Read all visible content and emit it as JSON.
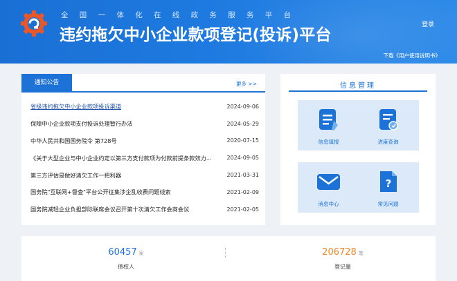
{
  "header": {
    "subtitle": "全国一体化在线政务服务平台",
    "title": "违约拖欠中小企业款项登记(投诉)平台",
    "login_label": "登录",
    "download_label": "下载《用户使用说明书》"
  },
  "notice": {
    "tab_label": "通知公告",
    "more_label": "更多 >>",
    "items": [
      {
        "title": "省级违约拖欠中小企业款项投诉渠道",
        "date": "2024-09-06"
      },
      {
        "title": "保障中小企业款项支付投诉处理暂行办法",
        "date": "2024-05-29"
      },
      {
        "title": "中华人民共和国国务院令 第728号",
        "date": "2020-07-15"
      },
      {
        "title": "《关于大型企业与中小企业约定以第三方支付款项为付款前提条款效力...",
        "date": "2024-09-05"
      },
      {
        "title": "第三方评估是做好清欠工作一把利器",
        "date": "2021-03-31"
      },
      {
        "title": "国务院\"互联网+督查\"平台公开征集涉企乱收费问题线索",
        "date": "2021-02-09"
      },
      {
        "title": "国务院减轻企业负担部际联席会议召开第十次清欠工作会商会议",
        "date": "2021-02-05"
      }
    ]
  },
  "info": {
    "title": "信息管理",
    "tiles": [
      {
        "label": "信息填报",
        "icon": "document-edit-icon"
      },
      {
        "label": "进度查询",
        "icon": "progress-query-icon"
      },
      {
        "label": "消息中心",
        "icon": "envelope-icon"
      },
      {
        "label": "常见问题",
        "icon": "question-document-icon"
      }
    ]
  },
  "stats": {
    "creditors": {
      "value": "60457",
      "unit": "家",
      "label": "债权人"
    },
    "registrations": {
      "value": "206728",
      "unit": "笔",
      "label": "登记量"
    }
  },
  "colors": {
    "primary": "#1d72d8",
    "accent_orange": "#f08423",
    "tile_bg": "#dbe9f9"
  }
}
